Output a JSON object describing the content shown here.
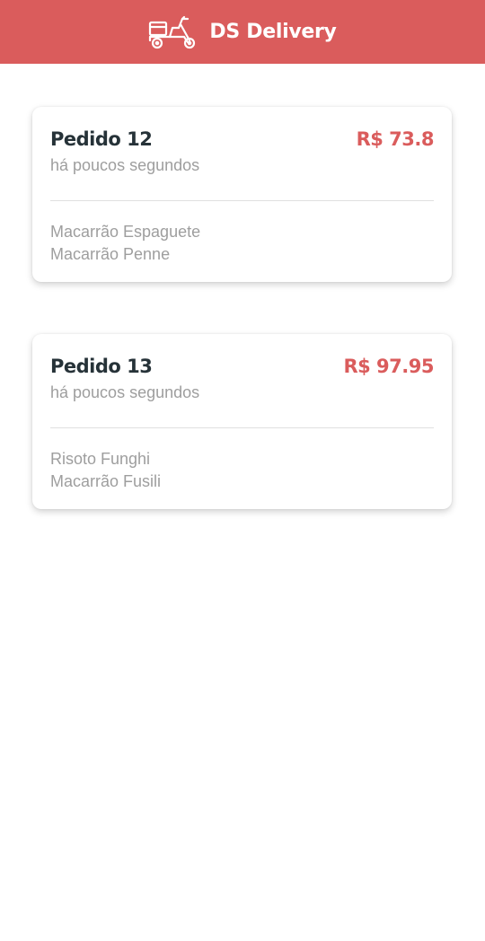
{
  "app": {
    "title": "DS Delivery",
    "logo_icon": "scooter-icon",
    "colors": {
      "primary": "#DA5C5C",
      "title_text": "#263238",
      "secondary_text": "#9E9E9E"
    }
  },
  "orders": [
    {
      "title": "Pedido 12",
      "price": "R$ 73.8",
      "time": "há poucos segundos",
      "products": [
        "Macarrão Espaguete",
        "Macarrão Penne"
      ]
    },
    {
      "title": "Pedido 13",
      "price": "R$ 97.95",
      "time": "há poucos segundos",
      "products": [
        "Risoto Funghi",
        "Macarrão Fusili"
      ]
    }
  ]
}
